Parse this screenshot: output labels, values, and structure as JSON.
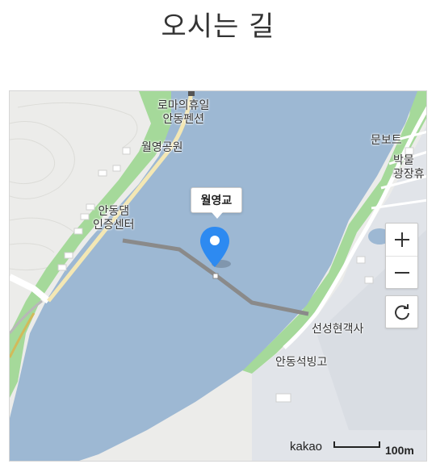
{
  "page": {
    "title": "오시는 길"
  },
  "map": {
    "marker_label": "월영교",
    "labels": {
      "roma_line1": "로마의휴일",
      "roma_line2": "안동펜션",
      "park": "월영공원",
      "dam_line1": "안동댐",
      "dam_line2": "인증센터",
      "munbo": "문보트",
      "museum_line1": "박물",
      "museum_line2": "광장휴",
      "seonseong": "선성현객사",
      "seokbing": "안동석빙고"
    },
    "attribution": "kakao",
    "scale_label": "100m",
    "colors": {
      "water": "#9db8d3",
      "land": "#ececea",
      "park": "#a5d99a",
      "road": "#ffffff",
      "marker": "#2d8af1"
    }
  },
  "controls": {
    "zoom_in_icon": "plus-icon",
    "zoom_out_icon": "minus-icon",
    "reset_icon": "refresh-icon"
  }
}
